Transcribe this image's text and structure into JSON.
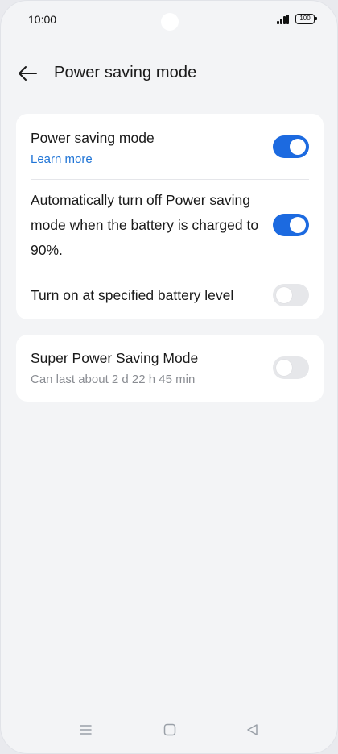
{
  "status_bar": {
    "time": "10:00",
    "battery_level": "100",
    "icons": [
      "signal-icon",
      "battery-icon"
    ]
  },
  "header": {
    "back_icon": "arrow-left-icon",
    "title": "Power saving mode"
  },
  "cards": {
    "main": {
      "power_saving": {
        "title": "Power saving mode",
        "link": "Learn more",
        "enabled": true
      },
      "auto_off": {
        "title": "Automatically turn off Power saving mode when the battery is charged to 90%.",
        "enabled": true
      },
      "battery_level": {
        "title": "Turn on at specified battery level",
        "enabled": false
      }
    },
    "super": {
      "title": "Super Power Saving Mode",
      "subtitle": "Can last about 2 d 22 h 45 min",
      "enabled": false
    }
  },
  "colors": {
    "accent": "#1c6ae0",
    "link": "#1f74d6",
    "background": "#f3f4f6",
    "card": "#ffffff",
    "toggle_off": "#e6e7ea"
  },
  "nav_bar": {
    "icons": [
      "menu-icon",
      "home-icon",
      "back-triangle-icon"
    ]
  }
}
